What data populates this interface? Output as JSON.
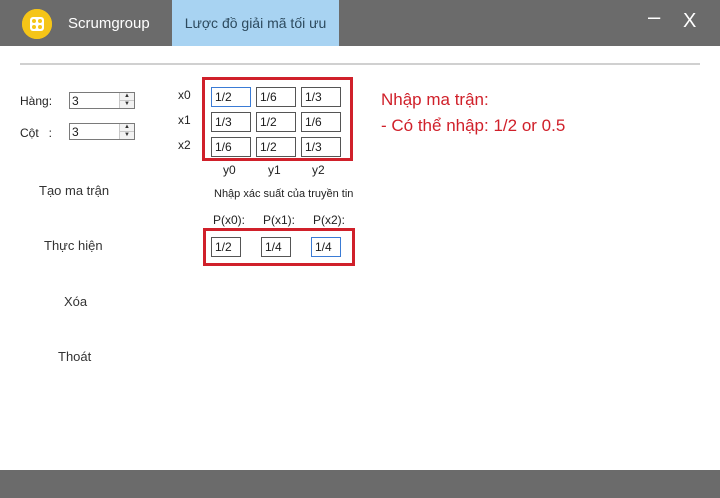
{
  "window": {
    "app_title": "Scrumgroup",
    "tab_label": "Lược đồ giải mã tối ưu",
    "minimize_glyph": "–",
    "close_glyph": "X"
  },
  "params": {
    "rows_label": "Hàng:",
    "rows_value": "3",
    "cols_label": "Cột   :",
    "cols_value": "3"
  },
  "menu": {
    "create_matrix": "Tạo ma trận",
    "execute": "Thực hiện",
    "delete": "Xóa",
    "exit": "Thoát"
  },
  "matrix": {
    "row_labels": [
      "x0",
      "x1",
      "x2"
    ],
    "col_labels": [
      "y0",
      "y1",
      "y2"
    ],
    "cells": [
      [
        "1/2",
        "1/6",
        "1/3"
      ],
      [
        "1/3",
        "1/2",
        "1/6"
      ],
      [
        "1/6",
        "1/2",
        "1/3"
      ]
    ]
  },
  "probabilities": {
    "caption": "Nhập xác suất của truyền tin",
    "labels": [
      "P(x0):",
      "P(x1):",
      "P(x2):"
    ],
    "values": [
      "1/2",
      "1/4",
      "1/4"
    ]
  },
  "annotation": {
    "title": "Nhập ma trận:",
    "line": "- Có thể nhập: 1/2 or 0.5"
  },
  "colors": {
    "titlebar": "#6b6b6b",
    "tab_active": "#a8d3f2",
    "highlight_border": "#d0202a",
    "logo": "#f5c518"
  }
}
